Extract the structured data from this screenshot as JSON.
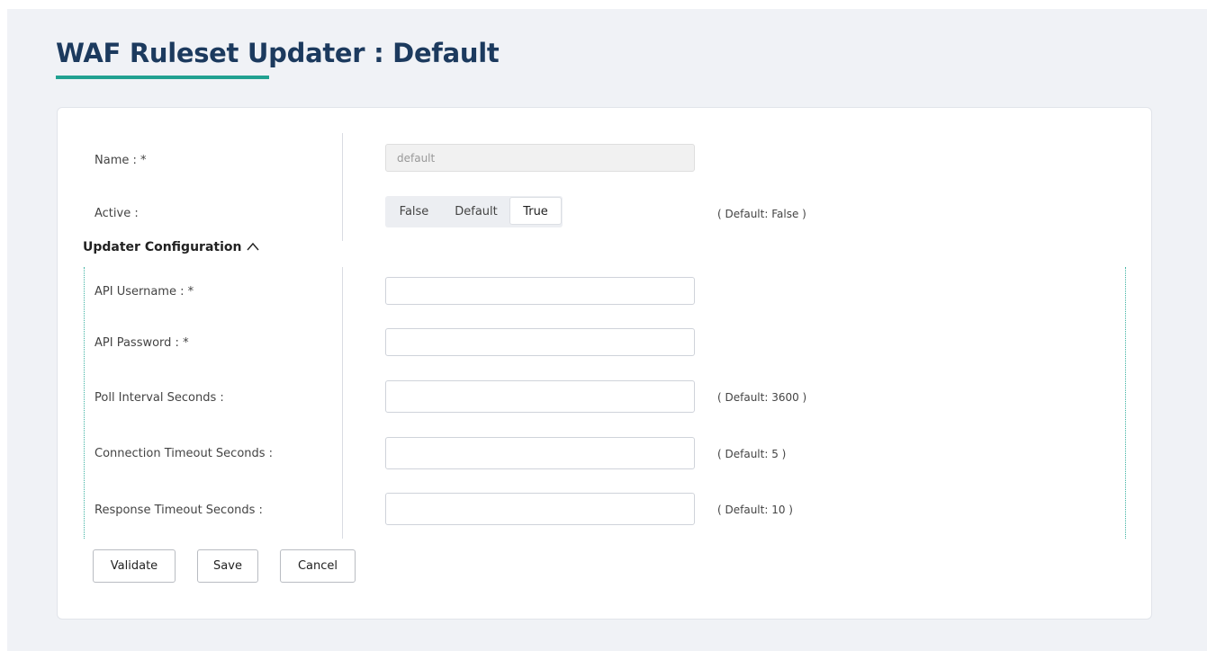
{
  "page": {
    "title": "WAF Ruleset Updater : Default"
  },
  "form": {
    "name": {
      "label": "Name : *",
      "value": "default"
    },
    "active": {
      "label": "Active :",
      "options": [
        "False",
        "Default",
        "True"
      ],
      "selected": "True",
      "hint": "( Default: False )"
    },
    "section": {
      "title": "Updater Configuration",
      "expanded": true
    },
    "api_username": {
      "label": "API Username : *",
      "value": ""
    },
    "api_password": {
      "label": "API Password : *",
      "value": ""
    },
    "poll_interval": {
      "label": "Poll Interval Seconds :",
      "value": "",
      "hint": "( Default: 3600 )"
    },
    "connection_timeout": {
      "label": "Connection Timeout Seconds :",
      "value": "",
      "hint": "( Default: 5 )"
    },
    "response_timeout": {
      "label": "Response Timeout Seconds :",
      "value": "",
      "hint": "( Default: 10 )"
    }
  },
  "buttons": {
    "validate": "Validate",
    "save": "Save",
    "cancel": "Cancel"
  },
  "colors": {
    "title": "#1c3a5e",
    "accent": "#21a191",
    "background": "#f0f2f6"
  }
}
